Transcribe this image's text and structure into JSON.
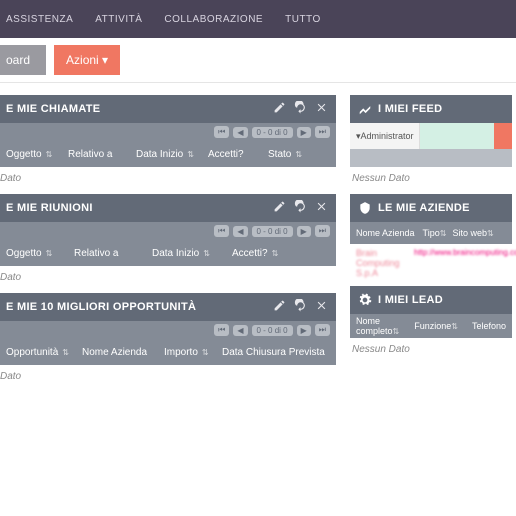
{
  "nav": {
    "items": [
      "ASSISTENZA",
      "ATTIVITÀ",
      "COLLABORAZIONE",
      "TUTTO"
    ]
  },
  "subbar": {
    "board": "oard",
    "actions": "Azioni ▾"
  },
  "calls": {
    "title": "E MIE CHIAMATE",
    "pager_range": "0 - 0 di 0",
    "cols": [
      "Oggetto",
      "Relativo a",
      "Data Inizio",
      "Accetti?",
      "Stato"
    ],
    "nodata": "Dato"
  },
  "meetings": {
    "title": "E MIE RIUNIONI",
    "pager_range": "0 - 0 di 0",
    "cols": [
      "Oggetto",
      "Relativo a",
      "Data Inizio",
      "Accetti?"
    ],
    "nodata": "Dato"
  },
  "opps": {
    "title": "E MIE 10 MIGLIORI OPPORTUNITÀ",
    "pager_range": "0 - 0 di 0",
    "cols": [
      "Opportunità",
      "Nome Azienda",
      "Importo",
      "Data Chiusura Prevista"
    ],
    "nodata": "Dato"
  },
  "feed": {
    "title": "I MIEI FEED",
    "admin": "▾Administrator",
    "nodata": "Nessun Dato"
  },
  "aziende": {
    "title": "LE MIE AZIENDE",
    "cols": [
      "Nome Azienda",
      "Tipo",
      "Sito web"
    ],
    "row": {
      "name": "Brain Computing S.p.A",
      "link": "http://www.braincomputing.com"
    }
  },
  "leads": {
    "title": "I MIEI LEAD",
    "cols": [
      "Nome completo",
      "Funzione",
      "Telefono"
    ],
    "nodata": "Nessun Dato"
  }
}
